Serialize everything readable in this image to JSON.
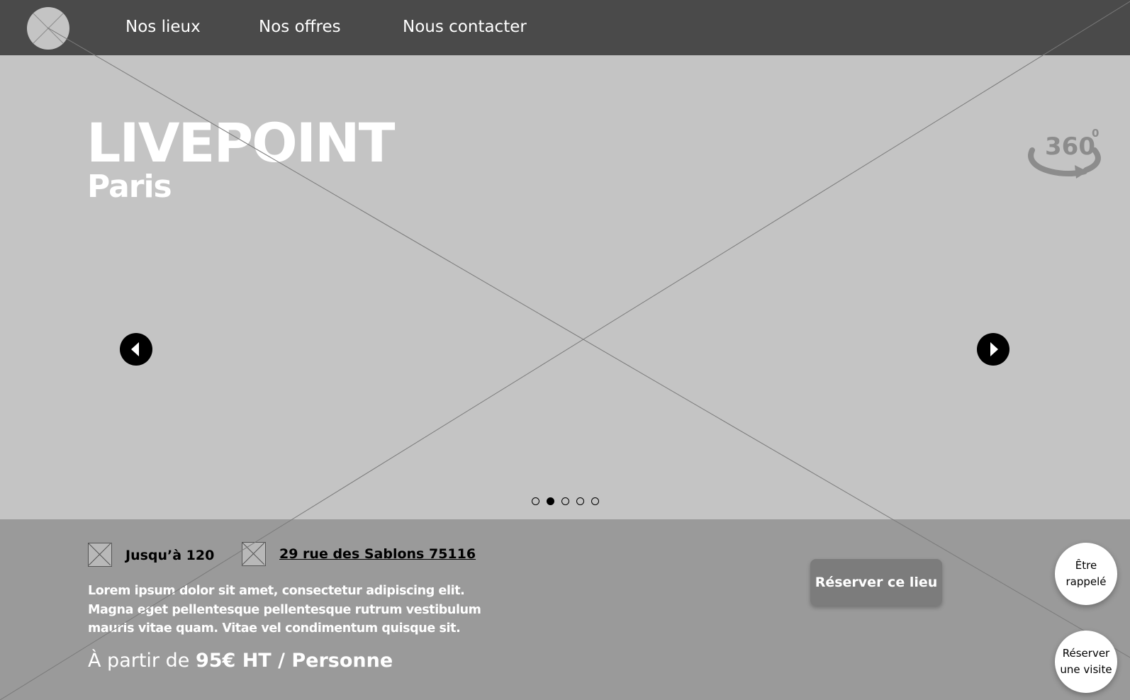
{
  "nav": {
    "links": [
      "Nos lieux",
      "Nos offres",
      "Nous contacter"
    ]
  },
  "hero": {
    "title": "LIVEPOINT",
    "subtitle": "Paris",
    "view360": {
      "label": "360",
      "superscript": "0",
      "icon": "360-view-icon"
    },
    "carousel": {
      "slide_count": 5,
      "active_index": 1
    }
  },
  "info": {
    "capacity": "Jusqu’à 120",
    "address": "29 rue des Sablons 75116",
    "description_lines": [
      "Lorem ipsum dolor sit amet, consectetur adipiscing elit.",
      "Magna eget pellentesque pellentesque rutrum vestibulum",
      "mauris vitae quam. Vitae vel condimentum quisque sit."
    ],
    "price_prefix": "À partir de ",
    "price_value": "95€ HT / Personne",
    "book_label": "Réserver ce lieu"
  },
  "floating": {
    "callback_lines": [
      "Être",
      "rappelé"
    ],
    "visit_lines": [
      "Réserver",
      "une visite"
    ]
  },
  "colors": {
    "header_bg": "#4a4a4a",
    "hero_bg": "#c4c4c4",
    "info_bg": "#9a9a9a",
    "button_bg": "#7c7c7c"
  }
}
